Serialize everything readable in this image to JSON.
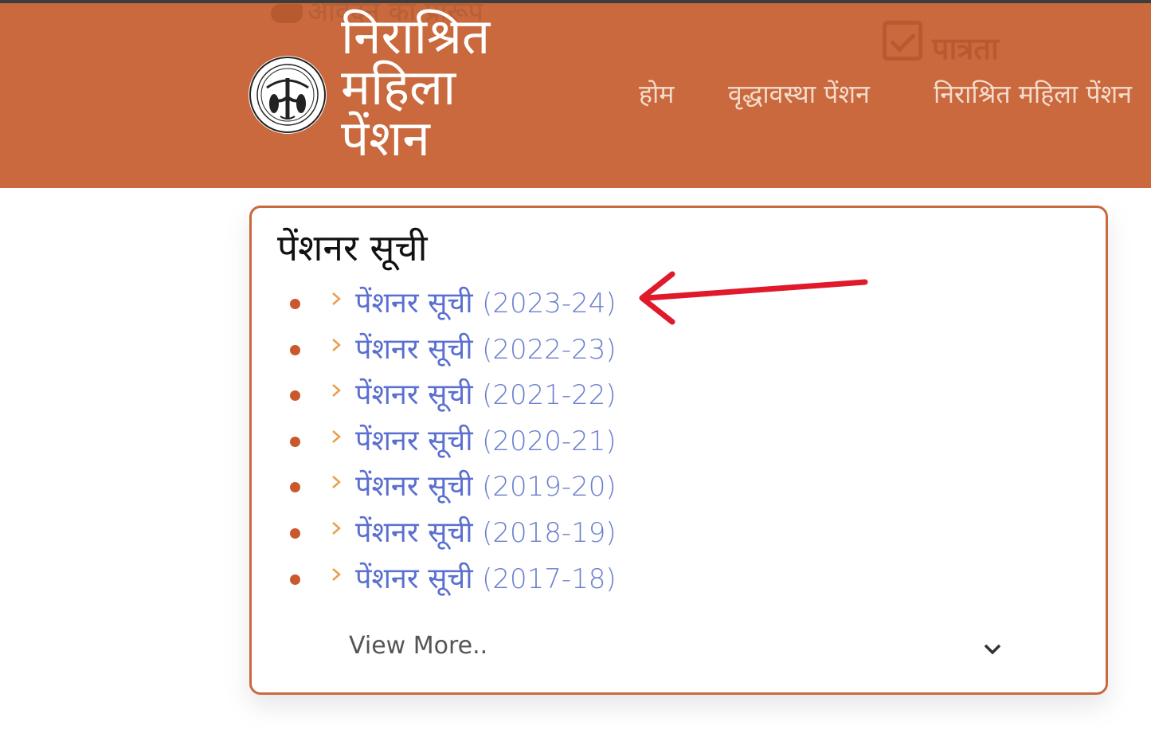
{
  "header": {
    "ghost_apply_text": "आवेदन का प्रारूप",
    "ghost_eligibility": "पात्रता",
    "brand_lines": [
      "निराश्रित",
      "महिला",
      "पेंशन"
    ],
    "nav": {
      "home": "होम",
      "old_age": "वृद्धावस्था पेंशन",
      "destitute": "निराश्रित महिला पेंशन"
    }
  },
  "card": {
    "title": "पेंशनर सूची",
    "items": [
      {
        "label": "पेंशनर सूची",
        "year": "(2023-24)"
      },
      {
        "label": "पेंशनर सूची",
        "year": "(2022-23)"
      },
      {
        "label": "पेंशनर सूची",
        "year": "(2021-22)"
      },
      {
        "label": "पेंशनर सूची",
        "year": "(2020-21)"
      },
      {
        "label": "पेंशनर सूची",
        "year": "(2019-20)"
      },
      {
        "label": "पेंशनर सूची",
        "year": "(2018-19)"
      },
      {
        "label": "पेंशनर सूची",
        "year": "(2017-18)"
      }
    ],
    "view_more": "View More.."
  },
  "colors": {
    "header_bg": "#c9693d",
    "accent": "#c9582c",
    "link": "#5a6fd0",
    "chevron": "#e8a04a",
    "annotation_arrow": "#e0192b"
  },
  "icons": {
    "emblem": "up-government-emblem-icon",
    "list_chevron": "chevron-right-icon",
    "view_more_chevron": "chevron-down-icon",
    "annotation": "red-arrow-icon"
  }
}
